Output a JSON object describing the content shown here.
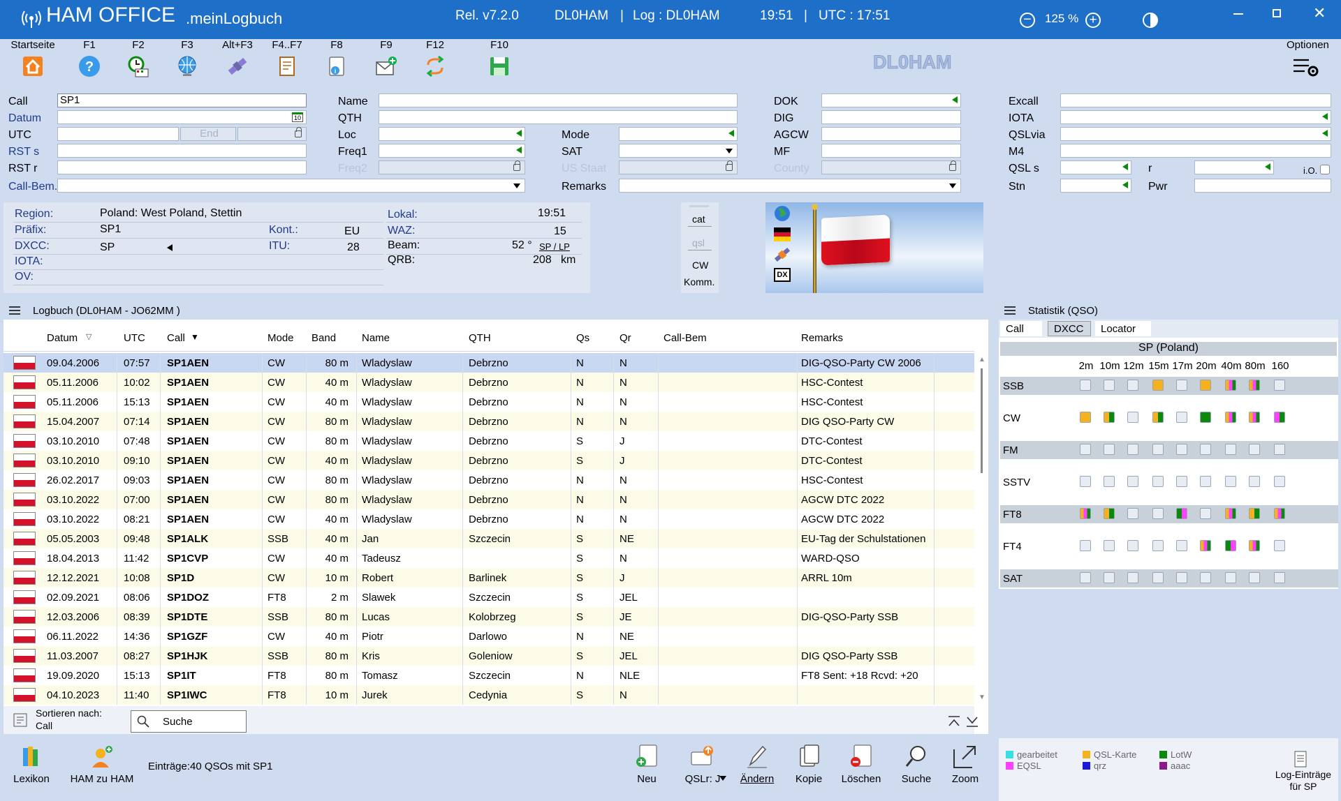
{
  "title": {
    "app": "HAM OFFICE",
    "sub": ".meinLogbuch",
    "release": "Rel. v7.2.0",
    "station": "DL0HAM",
    "log": "Log : DL0HAM",
    "time": "19:51",
    "utc": "UTC : 17:51",
    "zoom": "125 %"
  },
  "toolbar": {
    "items": [
      {
        "key": "Startseite",
        "icon": "home-icon"
      },
      {
        "key": "F1",
        "icon": "help-icon"
      },
      {
        "key": "F2",
        "icon": "clock-log-icon"
      },
      {
        "key": "F3",
        "icon": "globe-icon"
      },
      {
        "key": "Alt+F3",
        "icon": "satellite-icon"
      },
      {
        "key": "F4..F7",
        "icon": "document-icon"
      },
      {
        "key": "F8",
        "icon": "info-document-icon"
      },
      {
        "key": "F9",
        "icon": "mail-add-icon"
      },
      {
        "key": "F12",
        "icon": "sync-icon"
      },
      {
        "key": "F10",
        "icon": "save-icon"
      }
    ],
    "callsign_display": "DL0HAM",
    "options": "Optionen"
  },
  "form": {
    "call_label": "Call",
    "call_value": "SP1",
    "datum_label": "Datum",
    "cal_day": "10",
    "utc_label": "UTC",
    "end_label": "End",
    "rsts_label": "RST s",
    "rstr_label": "RST r",
    "callbem_label": "Call-Bem.",
    "name_label": "Name",
    "qth_label": "QTH",
    "loc_label": "Loc",
    "freq1_label": "Freq1",
    "freq2_label": "Freq2",
    "mode_label": "Mode",
    "sat_label": "SAT",
    "usstaat_label": "US Staat",
    "remarks_label": "Remarks",
    "dok_label": "DOK",
    "dig_label": "DIG",
    "agcw_label": "AGCW",
    "mf_label": "MF",
    "county_label": "County",
    "excall_label": "Excall",
    "iota_label": "IOTA",
    "qslvia_label": "QSLvia",
    "m4_label": "M4",
    "qsls_label": "QSL s",
    "r_label": "r",
    "io_label": "i.O.",
    "stn_label": "Stn",
    "pwr_label": "Pwr"
  },
  "info": {
    "region_label": "Region:",
    "region": "Poland: West Poland, Stettin",
    "prefix_label": "Präfix:",
    "prefix": "SP1",
    "kont_label": "Kont.:",
    "kont": "EU",
    "dxcc_label": "DXCC:",
    "dxcc": "SP",
    "itu_label": "ITU:",
    "itu": "28",
    "iota_label": "IOTA:",
    "ov_label": "OV:",
    "lokal_label": "Lokal:",
    "lokal": "19:51",
    "waz_label": "WAZ:",
    "waz": "15",
    "beam_label": "Beam:",
    "beam": "52 °",
    "beam_link": "SP / LP",
    "qrb_label": "QRB:",
    "qrb": "208",
    "qrb_unit": "km",
    "side": {
      "cat": "cat",
      "qsl": "qsl",
      "cw": "CW",
      "komm": "Komm."
    },
    "dx_icon": "DX"
  },
  "log": {
    "header": "Logbuch  (DL0HAM - JO62MM )",
    "columns": [
      "Datum",
      "UTC",
      "Call",
      "Mode",
      "Band",
      "Name",
      "QTH",
      "Qs",
      "Qr",
      "Call-Bem",
      "Remarks"
    ],
    "rows": [
      [
        "09.04.2006",
        "07:57",
        "SP1AEN",
        "CW",
        "80 m",
        "Wladyslaw",
        "Debrzno",
        "N",
        "N",
        "",
        "DIG-QSO-Party CW 2006"
      ],
      [
        "05.11.2006",
        "10:02",
        "SP1AEN",
        "CW",
        "40 m",
        "Wladyslaw",
        "Debrzno",
        "N",
        "N",
        "",
        "HSC-Contest"
      ],
      [
        "05.11.2006",
        "15:13",
        "SP1AEN",
        "CW",
        "40 m",
        "Wladyslaw",
        "Debrzno",
        "N",
        "N",
        "",
        "HSC-Contest"
      ],
      [
        "15.04.2007",
        "07:14",
        "SP1AEN",
        "CW",
        "80 m",
        "Wladyslaw",
        "Debrzno",
        "N",
        "N",
        "",
        "DIG QSO-Party CW"
      ],
      [
        "03.10.2010",
        "07:48",
        "SP1AEN",
        "CW",
        "80 m",
        "Wladyslaw",
        "Debrzno",
        "S",
        "J",
        "",
        "DTC-Contest"
      ],
      [
        "03.10.2010",
        "09:10",
        "SP1AEN",
        "CW",
        "40 m",
        "Wladyslaw",
        "Debrzno",
        "S",
        "J",
        "",
        "DTC-Contest"
      ],
      [
        "26.02.2017",
        "09:03",
        "SP1AEN",
        "CW",
        "80 m",
        "Wladyslaw",
        "Debrzno",
        "N",
        "N",
        "",
        "HSC-Contest"
      ],
      [
        "03.10.2022",
        "07:00",
        "SP1AEN",
        "CW",
        "80 m",
        "Wladyslaw",
        "Debrzno",
        "N",
        "N",
        "",
        "AGCW DTC 2022"
      ],
      [
        "03.10.2022",
        "08:21",
        "SP1AEN",
        "CW",
        "40 m",
        "Wladyslaw",
        "Debrzno",
        "N",
        "N",
        "",
        "AGCW DTC 2022"
      ],
      [
        "05.05.2003",
        "09:48",
        "SP1ALK",
        "SSB",
        "40 m",
        "Jan",
        "Szczecin",
        "S",
        "NE",
        "",
        "EU-Tag der Schulstationen"
      ],
      [
        "18.04.2013",
        "11:42",
        "SP1CVP",
        "CW",
        "40 m",
        "Tadeusz",
        "",
        "S",
        "N",
        "",
        "WARD-QSO"
      ],
      [
        "12.12.2021",
        "10:08",
        "SP1D",
        "CW",
        "10 m",
        "Robert",
        "Barlinek",
        "S",
        "J",
        "",
        "ARRL 10m"
      ],
      [
        "02.09.2021",
        "08:06",
        "SP1DOZ",
        "FT8",
        "2 m",
        "Slawek",
        "Szczecin",
        "S",
        "JEL",
        "",
        ""
      ],
      [
        "12.03.2006",
        "08:39",
        "SP1DTE",
        "SSB",
        "80 m",
        "Lucas",
        "Kolobrzeg",
        "S",
        "JE",
        "",
        "DIG-QSO-Party SSB"
      ],
      [
        "06.11.2022",
        "14:36",
        "SP1GZF",
        "CW",
        "40 m",
        "Piotr",
        "Darlowo",
        "N",
        "NE",
        "",
        ""
      ],
      [
        "11.03.2007",
        "08:27",
        "SP1HJK",
        "SSB",
        "80 m",
        "Kris",
        "Goleniow",
        "S",
        "JEL",
        "",
        "DIG QSO-Party SSB"
      ],
      [
        "19.09.2020",
        "15:13",
        "SP1IT",
        "FT8",
        "80 m",
        "Tomasz",
        "Szczecin",
        "N",
        "NLE",
        "",
        "FT8  Sent: +18  Rcvd: +20"
      ],
      [
        "04.10.2023",
        "11:40",
        "SP1IWC",
        "FT8",
        "10 m",
        "Jurek",
        "Cedynia",
        "S",
        "N",
        "",
        ""
      ]
    ],
    "sort_label": "Sortieren nach:",
    "sort_value": "Call",
    "search": "Suche"
  },
  "stats": {
    "title": "Statistik (QSO)",
    "tabs": [
      "Call",
      "DXCC",
      "Locator"
    ],
    "country": "SP (Poland)",
    "bands": [
      "2m",
      "10m",
      "12m",
      "15m",
      "17m",
      "20m",
      "40m",
      "80m",
      "160"
    ],
    "modes": [
      "SSB",
      "CW",
      "FM",
      "SSTV",
      "FT8",
      "FT4",
      "SAT"
    ],
    "cells": [
      [
        "",
        "",
        "",
        "o",
        "",
        "o",
        "oqg",
        "oqg",
        ""
      ],
      [
        "o",
        "og",
        "",
        "og",
        "",
        "g",
        "oqg",
        "oqg",
        "qg"
      ],
      [
        "",
        "",
        "",
        "",
        "",
        "",
        "",
        "",
        ""
      ],
      [
        "",
        "",
        "",
        "",
        "",
        "",
        "",
        "",
        ""
      ],
      [
        "oqg",
        "og",
        "",
        "",
        "gq",
        "",
        "oqg",
        "og",
        "oqg"
      ],
      [
        "",
        "",
        "",
        "",
        "",
        "oqg",
        "gq",
        "oqg",
        ""
      ],
      [
        "",
        "",
        "",
        "",
        "",
        "",
        "",
        "",
        ""
      ]
    ],
    "legend": [
      {
        "label": "gearbeitet",
        "color": "#35e0e0"
      },
      {
        "label": "QSL-Karte",
        "color": "#f5b21c"
      },
      {
        "label": "LotW",
        "color": "#0a8a0a"
      },
      {
        "label": "EQSL",
        "color": "#ff40ff"
      },
      {
        "label": "qrz",
        "color": "#1a1ad8"
      },
      {
        "label": "aaac",
        "color": "#8a1a8a"
      }
    ],
    "log_entries": "Log-Einträge für SP"
  },
  "bottom": {
    "lexikon": "Lexikon",
    "ham": "HAM zu HAM",
    "entries": "Einträge:40 QSOs mit SP1",
    "neu": "Neu",
    "qslr": "QSLr: J",
    "aendern": "Ändern",
    "kopie": "Kopie",
    "loeschen": "Löschen",
    "suche": "Suche",
    "zoom": "Zoom"
  },
  "colors": {
    "titlebar": "#1e6fc8",
    "accent_red": "#d5102a",
    "accent_green": "#0a8a0a",
    "orange": "#f5b21c"
  }
}
